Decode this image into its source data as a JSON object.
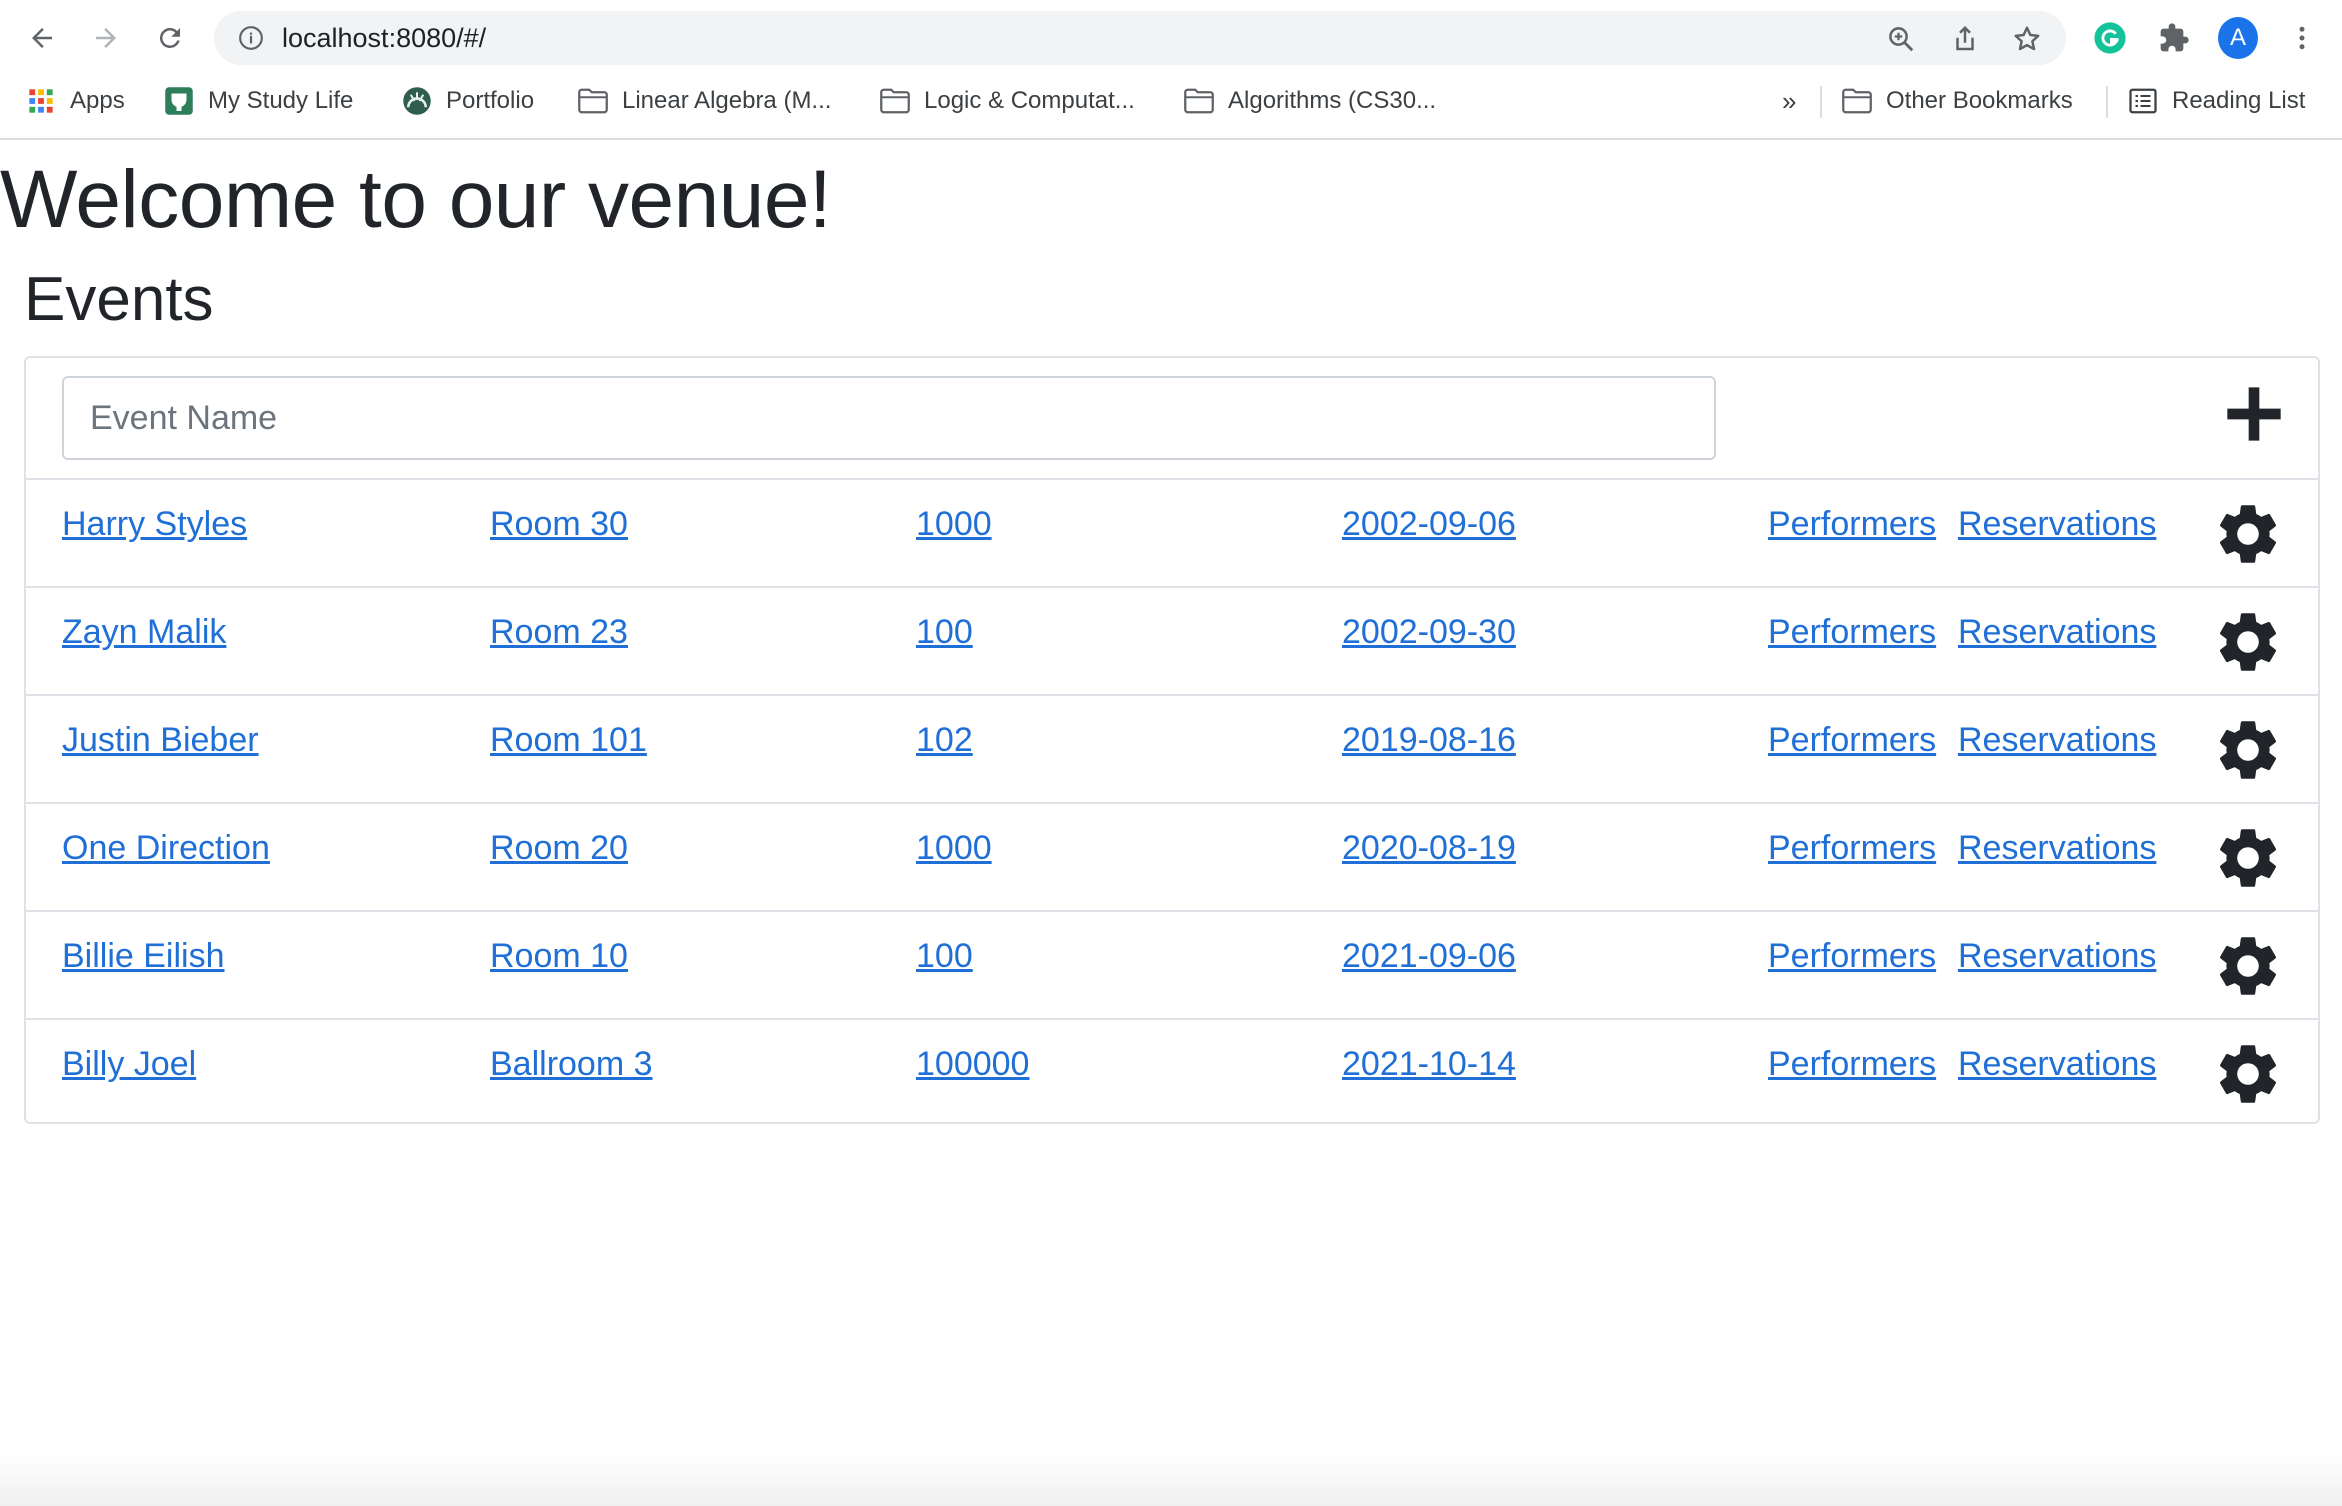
{
  "browser": {
    "url": "localhost:8080/#/",
    "profile_initial": "A",
    "bookmarks": [
      {
        "label": "Apps",
        "icon": "apps-grid-icon"
      },
      {
        "label": "My Study Life",
        "icon": "study-life-icon"
      },
      {
        "label": "Portfolio",
        "icon": "portfolio-icon"
      },
      {
        "label": "Linear Algebra (M...",
        "icon": "folder-icon"
      },
      {
        "label": "Logic & Computat...",
        "icon": "folder-icon"
      },
      {
        "label": "Algorithms (CS30...",
        "icon": "folder-icon"
      }
    ],
    "overflow_label": "»",
    "other_bookmarks": "Other Bookmarks",
    "reading_list": "Reading List"
  },
  "page": {
    "heading": "Welcome to our venue!",
    "subheading": "Events",
    "input_placeholder": "Event Name"
  },
  "events": [
    {
      "name": "Harry Styles",
      "room": "Room 30",
      "capacity": "1000",
      "date": "2002-09-06",
      "performers": "Performers",
      "reservations": "Reservations"
    },
    {
      "name": "Zayn Malik",
      "room": "Room 23",
      "capacity": "100",
      "date": "2002-09-30",
      "performers": "Performers",
      "reservations": "Reservations"
    },
    {
      "name": "Justin Bieber",
      "room": "Room 101",
      "capacity": "102",
      "date": "2019-08-16",
      "performers": "Performers",
      "reservations": "Reservations"
    },
    {
      "name": "One Direction",
      "room": "Room 20",
      "capacity": "1000",
      "date": "2020-08-19",
      "performers": "Performers",
      "reservations": "Reservations"
    },
    {
      "name": "Billie Eilish",
      "room": "Room 10",
      "capacity": "100",
      "date": "2021-09-06",
      "performers": "Performers",
      "reservations": "Reservations"
    },
    {
      "name": "Billy Joel",
      "room": "Ballroom 3",
      "capacity": "100000",
      "date": "2021-10-14",
      "performers": "Performers",
      "reservations": "Reservations"
    }
  ],
  "colors": {
    "link": "#1f6fd6",
    "text": "#212529",
    "border": "#dee2e6",
    "profile": "#1a73e8",
    "grammarly": "#15c39a"
  }
}
